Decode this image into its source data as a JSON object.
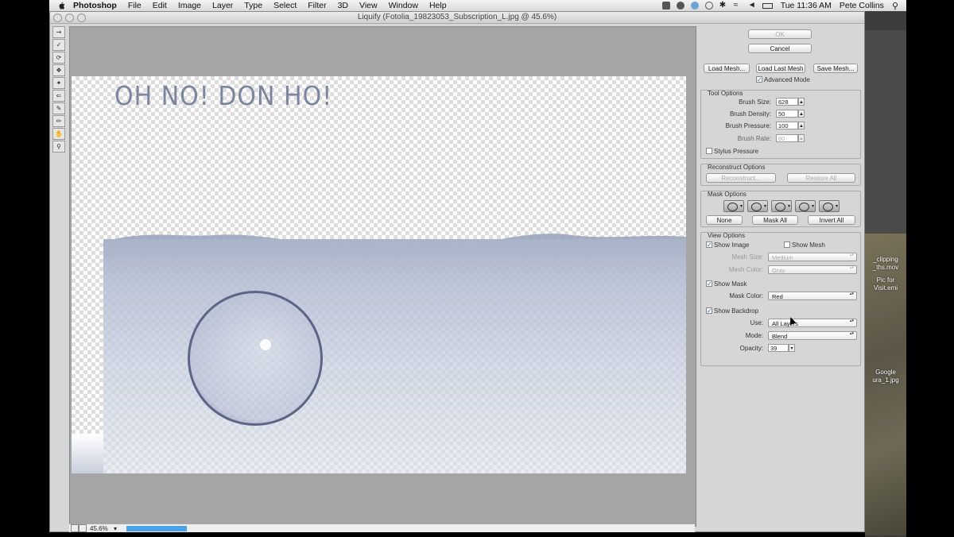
{
  "menubar": {
    "app": "Photoshop",
    "items": [
      "File",
      "Edit",
      "Image",
      "Layer",
      "Type",
      "Select",
      "Filter",
      "3D",
      "View",
      "Window",
      "Help"
    ],
    "clock": "Tue 11:36 AM",
    "user": "Pete Collins"
  },
  "window": {
    "title": "Liquify (Fotolia_19823053_Subscription_L.jpg @ 45.6%)"
  },
  "canvas": {
    "image_text": "OH NO! DON HO!",
    "zoom": "45.6%"
  },
  "panel": {
    "ok": "OK",
    "cancel": "Cancel",
    "load_mesh": "Load Mesh...",
    "load_last_mesh": "Load Last Mesh",
    "save_mesh": "Save Mesh...",
    "advanced_mode": "Advanced Mode",
    "tool_options": {
      "title": "Tool Options",
      "brush_size_label": "Brush Size:",
      "brush_size": "628",
      "brush_density_label": "Brush Density:",
      "brush_density": "50",
      "brush_pressure_label": "Brush Pressure:",
      "brush_pressure": "100",
      "brush_rate_label": "Brush Rate:",
      "brush_rate": "80",
      "stylus_pressure": "Stylus Pressure"
    },
    "reconstruct_options": {
      "title": "Reconstruct Options",
      "reconstruct": "Reconstruct...",
      "restore_all": "Restore All"
    },
    "mask_options": {
      "title": "Mask Options",
      "none": "None",
      "mask_all": "Mask All",
      "invert_all": "Invert All"
    },
    "view_options": {
      "title": "View Options",
      "show_image": "Show Image",
      "show_mesh": "Show Mesh",
      "mesh_size_label": "Mesh Size:",
      "mesh_size": "Medium",
      "mesh_color_label": "Mesh Color:",
      "mesh_color": "Gray",
      "show_mask": "Show Mask",
      "mask_color_label": "Mask Color:",
      "mask_color": "Red",
      "show_backdrop": "Show Backdrop",
      "use_label": "Use:",
      "use": "All Layers",
      "mode_label": "Mode:",
      "mode": "Blend",
      "opacity_label": "Opacity:",
      "opacity": "39"
    }
  },
  "desktop": {
    "labels": [
      "_clipping",
      "_ths.mov",
      "Pic for",
      "Visit.emi",
      "Google",
      "ura_1.jpg"
    ]
  },
  "colors": {
    "progress": "#4aa2e8",
    "checkbox_accent": "#1a5fc4"
  }
}
